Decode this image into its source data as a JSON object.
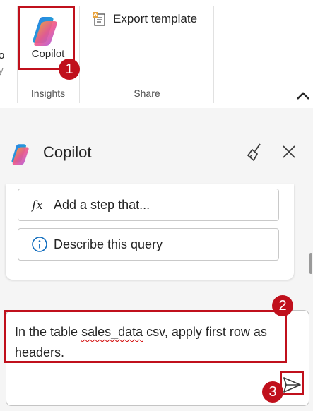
{
  "ribbon": {
    "left_cut_text": "o",
    "left_cut_text2": "y",
    "copilot_label": "Copilot",
    "export_label": "Export template",
    "group_insights": "Insights",
    "group_share": "Share"
  },
  "pane": {
    "title": "Copilot",
    "suggestions": [
      {
        "label": "Add a step that...",
        "icon": "function-fx-icon"
      },
      {
        "label": "Describe this query",
        "icon": "info-icon"
      }
    ],
    "input": {
      "parts": [
        "In the table ",
        "sales_data",
        " csv, apply first row as headers."
      ]
    }
  },
  "annotations": {
    "badge_1": "1",
    "badge_2": "2",
    "badge_3": "3",
    "color": "#c0101c"
  },
  "colors": {
    "accent_red": "#c0101c",
    "pane_bg": "#f5f5f5"
  }
}
